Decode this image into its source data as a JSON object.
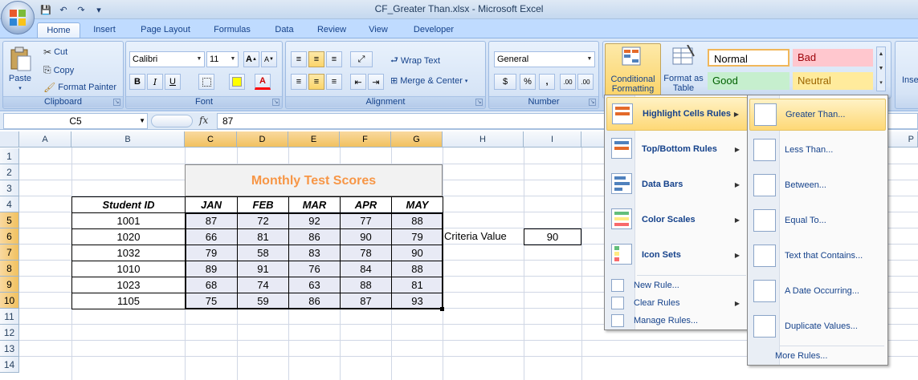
{
  "window": {
    "title": "CF_Greater Than.xlsx - Microsoft Excel"
  },
  "qat": {
    "save": "💾",
    "undo": "↶",
    "redo": "↷",
    "more": "▾"
  },
  "tabs": [
    "Home",
    "Insert",
    "Page Layout",
    "Formulas",
    "Data",
    "Review",
    "View",
    "Developer"
  ],
  "ribbon": {
    "clipboard": {
      "label": "Clipboard",
      "paste": "Paste",
      "cut": "Cut",
      "copy": "Copy",
      "format_painter": "Format Painter"
    },
    "font": {
      "label": "Font",
      "name": "Calibri",
      "size": "11",
      "grow": "A",
      "shrink": "A",
      "bold": "B",
      "italic": "I",
      "underline": "U",
      "font_color": "A"
    },
    "alignment": {
      "label": "Alignment",
      "wrap_text": "Wrap Text",
      "merge_center": "Merge & Center"
    },
    "number": {
      "label": "Number",
      "format": "General",
      "currency": "$",
      "percent": "%",
      "comma": ",",
      "inc_decimal": ".00",
      "dec_decimal": ".00"
    },
    "styles": {
      "conditional_formatting": "Conditional Formatting",
      "format_as_table": "Format as Table",
      "normal": "Normal",
      "bad": "Bad",
      "good": "Good",
      "neutral": "Neutral"
    },
    "cells": {
      "insert": "Inse"
    }
  },
  "formula_bar": {
    "name_box": "C5",
    "fx": "fx",
    "value": "87"
  },
  "sheet": {
    "columns": [
      "A",
      "B",
      "C",
      "D",
      "E",
      "F",
      "G",
      "H",
      "I",
      "P"
    ],
    "rows": [
      "1",
      "2",
      "3",
      "4",
      "5",
      "6",
      "7",
      "8",
      "9",
      "10",
      "11",
      "12",
      "13",
      "14"
    ],
    "title": "Monthly Test Scores",
    "headers": [
      "Student ID",
      "JAN",
      "FEB",
      "MAR",
      "APR",
      "MAY"
    ],
    "data": [
      [
        "1001",
        "87",
        "72",
        "92",
        "77",
        "88"
      ],
      [
        "1020",
        "66",
        "81",
        "86",
        "90",
        "79"
      ],
      [
        "1032",
        "79",
        "58",
        "83",
        "78",
        "90"
      ],
      [
        "1010",
        "89",
        "91",
        "76",
        "84",
        "88"
      ],
      [
        "1023",
        "68",
        "74",
        "63",
        "88",
        "81"
      ],
      [
        "1105",
        "75",
        "59",
        "86",
        "87",
        "93"
      ]
    ],
    "criteria_label": "Criteria Value",
    "criteria_value": "90"
  },
  "cf_menu": {
    "items": [
      "Highlight Cells Rules",
      "Top/Bottom Rules",
      "Data Bars",
      "Color Scales",
      "Icon Sets"
    ],
    "sub": [
      "New Rule...",
      "Clear Rules",
      "Manage Rules..."
    ]
  },
  "highlight_menu": {
    "items": [
      "Greater Than...",
      "Less Than...",
      "Between...",
      "Equal To...",
      "Text that Contains...",
      "A Date Occurring...",
      "Duplicate Values..."
    ],
    "more": "More Rules..."
  },
  "colors": {
    "title_orange": "#f79646",
    "ribbon_blue": "#bfdbff",
    "highlight": "#fed876"
  }
}
